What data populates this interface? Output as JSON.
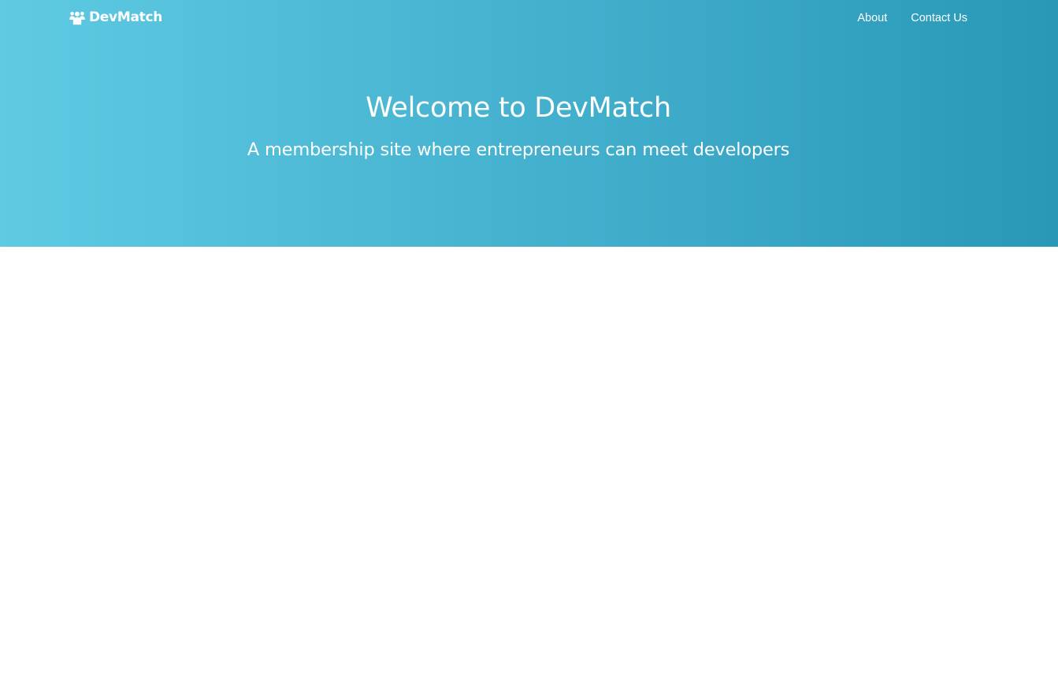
{
  "nav": {
    "brand": "DevMatch",
    "brand_icon": "users-icon",
    "links": [
      {
        "label": "About"
      },
      {
        "label": "Contact Us"
      }
    ]
  },
  "hero": {
    "title": "Welcome to DevMatch",
    "subtitle": "A membership site where entrepreneurs can meet developers"
  },
  "colors": {
    "gradient_start": "#5fcae2",
    "gradient_end": "#2898b6",
    "text": "#ffffff",
    "page_background": "#ffffff"
  }
}
